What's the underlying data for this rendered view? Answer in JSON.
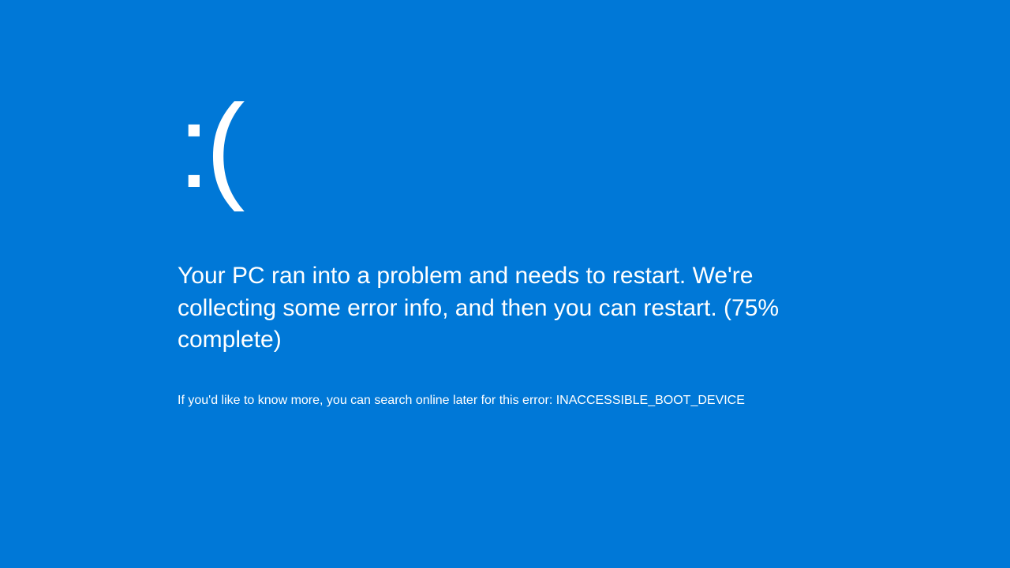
{
  "bsod": {
    "emoticon": ":(",
    "message": "Your PC ran into a problem and needs to restart. We're collecting some error info, and then you can restart. (75% complete)",
    "error_detail": "If you'd like to know more, you can search online later for this error: INACCESSIBLE_BOOT_DEVICE",
    "progress_percent": 75,
    "error_code": "INACCESSIBLE_BOOT_DEVICE",
    "background_color": "#0078d7",
    "text_color": "#ffffff"
  }
}
